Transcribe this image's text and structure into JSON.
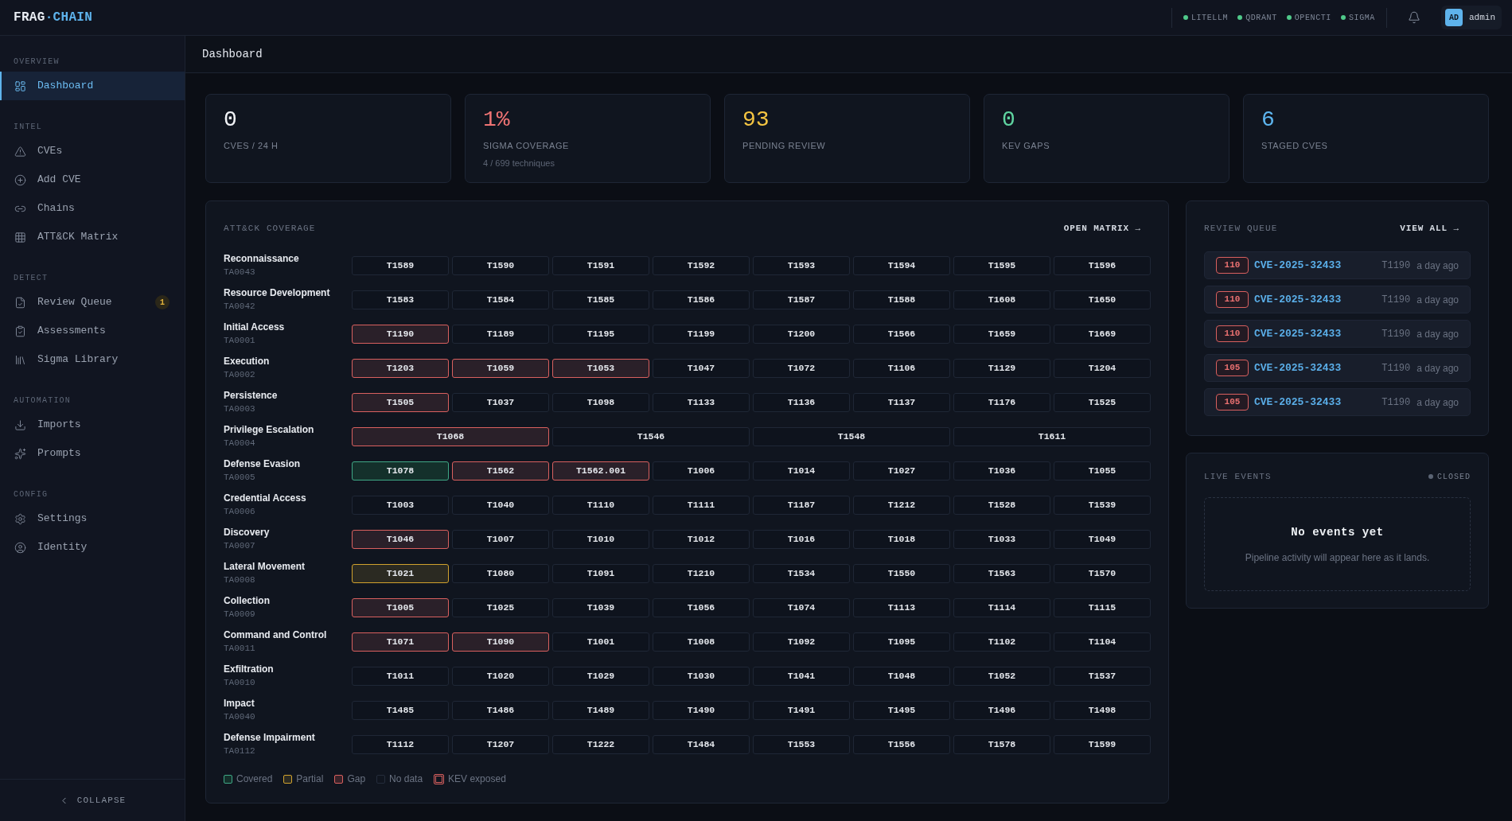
{
  "app": {
    "logo": {
      "name": "FRAG",
      "accent": "·CHAIN"
    }
  },
  "topbar": {
    "services": [
      {
        "label": "LITELLM",
        "online": true
      },
      {
        "label": "QDRANT",
        "online": true
      },
      {
        "label": "OPENCTI",
        "online": true
      },
      {
        "label": "SIGMA",
        "online": true
      }
    ],
    "user": {
      "initials": "AD",
      "name": "admin"
    }
  },
  "sidebar": {
    "sections": [
      {
        "title": "OVERVIEW",
        "items": [
          {
            "label": "Dashboard",
            "selected": true
          }
        ]
      },
      {
        "title": "INTEL",
        "items": [
          {
            "label": "CVEs",
            "selected": false
          },
          {
            "label": "Add CVE",
            "selected": false
          },
          {
            "label": "Chains",
            "selected": false
          },
          {
            "label": "ATT&CK Matrix",
            "selected": false
          }
        ]
      },
      {
        "title": "DETECT",
        "items": [
          {
            "label": "Review Queue",
            "selected": false,
            "badge": "1"
          },
          {
            "label": "Assessments",
            "selected": false
          },
          {
            "label": "Sigma Library",
            "selected": false
          }
        ]
      },
      {
        "title": "AUTOMATION",
        "items": [
          {
            "label": "Imports",
            "selected": false
          },
          {
            "label": "Prompts",
            "selected": false
          }
        ]
      },
      {
        "title": "CONFIG",
        "items": [
          {
            "label": "Settings",
            "selected": false
          },
          {
            "label": "Identity",
            "selected": false
          }
        ]
      }
    ],
    "collapse": "COLLAPSE"
  },
  "page": {
    "title": "Dashboard"
  },
  "stats": [
    {
      "value": "0",
      "label": "CVES / 24 H",
      "color": "#f1f3f6"
    },
    {
      "value": "1%",
      "label": "SIGMA COVERAGE",
      "sub": "4 / 699 techniques",
      "color": "#f07474"
    },
    {
      "value": "93",
      "label": "PENDING REVIEW",
      "color": "#f5c542"
    },
    {
      "value": "0",
      "label": "KEV GAPS",
      "color": "#5fd4a0"
    },
    {
      "value": "6",
      "label": "STAGED CVES",
      "color": "#5eb6f0"
    }
  ],
  "matrix": {
    "title": "ATT&CK COVERAGE",
    "link": "OPEN MATRIX →",
    "tactics": [
      {
        "name": "Reconnaissance",
        "id": "TA0043",
        "techniques": [
          {
            "id": "T1589",
            "kind": "none"
          },
          {
            "id": "T1590",
            "kind": "none"
          },
          {
            "id": "T1591",
            "kind": "none"
          },
          {
            "id": "T1592",
            "kind": "none"
          },
          {
            "id": "T1593",
            "kind": "none"
          },
          {
            "id": "T1594",
            "kind": "none"
          },
          {
            "id": "T1595",
            "kind": "none"
          },
          {
            "id": "T1596",
            "kind": "none"
          }
        ]
      },
      {
        "name": "Resource Development",
        "id": "TA0042",
        "techniques": [
          {
            "id": "T1583",
            "kind": "none"
          },
          {
            "id": "T1584",
            "kind": "none"
          },
          {
            "id": "T1585",
            "kind": "none"
          },
          {
            "id": "T1586",
            "kind": "none"
          },
          {
            "id": "T1587",
            "kind": "none"
          },
          {
            "id": "T1588",
            "kind": "none"
          },
          {
            "id": "T1608",
            "kind": "none"
          },
          {
            "id": "T1650",
            "kind": "none"
          }
        ]
      },
      {
        "name": "Initial Access",
        "id": "TA0001",
        "techniques": [
          {
            "id": "T1190",
            "kind": "gap"
          },
          {
            "id": "T1189",
            "kind": "none"
          },
          {
            "id": "T1195",
            "kind": "none"
          },
          {
            "id": "T1199",
            "kind": "none"
          },
          {
            "id": "T1200",
            "kind": "none"
          },
          {
            "id": "T1566",
            "kind": "none"
          },
          {
            "id": "T1659",
            "kind": "none"
          },
          {
            "id": "T1669",
            "kind": "none"
          }
        ]
      },
      {
        "name": "Execution",
        "id": "TA0002",
        "techniques": [
          {
            "id": "T1203",
            "kind": "gap"
          },
          {
            "id": "T1059",
            "kind": "gap"
          },
          {
            "id": "T1053",
            "kind": "gap"
          },
          {
            "id": "T1047",
            "kind": "none"
          },
          {
            "id": "T1072",
            "kind": "none"
          },
          {
            "id": "T1106",
            "kind": "none"
          },
          {
            "id": "T1129",
            "kind": "none"
          },
          {
            "id": "T1204",
            "kind": "none"
          }
        ]
      },
      {
        "name": "Persistence",
        "id": "TA0003",
        "techniques": [
          {
            "id": "T1505",
            "kind": "gap"
          },
          {
            "id": "T1037",
            "kind": "none"
          },
          {
            "id": "T1098",
            "kind": "none"
          },
          {
            "id": "T1133",
            "kind": "none"
          },
          {
            "id": "T1136",
            "kind": "none"
          },
          {
            "id": "T1137",
            "kind": "none"
          },
          {
            "id": "T1176",
            "kind": "none"
          },
          {
            "id": "T1525",
            "kind": "none"
          }
        ]
      },
      {
        "name": "Privilege Escalation",
        "id": "TA0004",
        "techniques": [
          {
            "id": "T1068",
            "kind": "gap"
          },
          {
            "id": "T1546",
            "kind": "none"
          },
          {
            "id": "T1548",
            "kind": "none"
          },
          {
            "id": "T1611",
            "kind": "none"
          }
        ]
      },
      {
        "name": "Defense Evasion",
        "id": "TA0005",
        "techniques": [
          {
            "id": "T1078",
            "kind": "covered"
          },
          {
            "id": "T1562",
            "kind": "gap"
          },
          {
            "id": "T1562.001",
            "kind": "gap"
          },
          {
            "id": "T1006",
            "kind": "none"
          },
          {
            "id": "T1014",
            "kind": "none"
          },
          {
            "id": "T1027",
            "kind": "none"
          },
          {
            "id": "T1036",
            "kind": "none"
          },
          {
            "id": "T1055",
            "kind": "none"
          }
        ]
      },
      {
        "name": "Credential Access",
        "id": "TA0006",
        "techniques": [
          {
            "id": "T1003",
            "kind": "none"
          },
          {
            "id": "T1040",
            "kind": "none"
          },
          {
            "id": "T1110",
            "kind": "none"
          },
          {
            "id": "T1111",
            "kind": "none"
          },
          {
            "id": "T1187",
            "kind": "none"
          },
          {
            "id": "T1212",
            "kind": "none"
          },
          {
            "id": "T1528",
            "kind": "none"
          },
          {
            "id": "T1539",
            "kind": "none"
          }
        ]
      },
      {
        "name": "Discovery",
        "id": "TA0007",
        "techniques": [
          {
            "id": "T1046",
            "kind": "gap"
          },
          {
            "id": "T1007",
            "kind": "none"
          },
          {
            "id": "T1010",
            "kind": "none"
          },
          {
            "id": "T1012",
            "kind": "none"
          },
          {
            "id": "T1016",
            "kind": "none"
          },
          {
            "id": "T1018",
            "kind": "none"
          },
          {
            "id": "T1033",
            "kind": "none"
          },
          {
            "id": "T1049",
            "kind": "none"
          }
        ]
      },
      {
        "name": "Lateral Movement",
        "id": "TA0008",
        "techniques": [
          {
            "id": "T1021",
            "kind": "partial"
          },
          {
            "id": "T1080",
            "kind": "none"
          },
          {
            "id": "T1091",
            "kind": "none"
          },
          {
            "id": "T1210",
            "kind": "none"
          },
          {
            "id": "T1534",
            "kind": "none"
          },
          {
            "id": "T1550",
            "kind": "none"
          },
          {
            "id": "T1563",
            "kind": "none"
          },
          {
            "id": "T1570",
            "kind": "none"
          }
        ]
      },
      {
        "name": "Collection",
        "id": "TA0009",
        "techniques": [
          {
            "id": "T1005",
            "kind": "gap"
          },
          {
            "id": "T1025",
            "kind": "none"
          },
          {
            "id": "T1039",
            "kind": "none"
          },
          {
            "id": "T1056",
            "kind": "none"
          },
          {
            "id": "T1074",
            "kind": "none"
          },
          {
            "id": "T1113",
            "kind": "none"
          },
          {
            "id": "T1114",
            "kind": "none"
          },
          {
            "id": "T1115",
            "kind": "none"
          }
        ]
      },
      {
        "name": "Command and Control",
        "id": "TA0011",
        "techniques": [
          {
            "id": "T1071",
            "kind": "gap"
          },
          {
            "id": "T1090",
            "kind": "gap"
          },
          {
            "id": "T1001",
            "kind": "none"
          },
          {
            "id": "T1008",
            "kind": "none"
          },
          {
            "id": "T1092",
            "kind": "none"
          },
          {
            "id": "T1095",
            "kind": "none"
          },
          {
            "id": "T1102",
            "kind": "none"
          },
          {
            "id": "T1104",
            "kind": "none"
          }
        ]
      },
      {
        "name": "Exfiltration",
        "id": "TA0010",
        "techniques": [
          {
            "id": "T1011",
            "kind": "none"
          },
          {
            "id": "T1020",
            "kind": "none"
          },
          {
            "id": "T1029",
            "kind": "none"
          },
          {
            "id": "T1030",
            "kind": "none"
          },
          {
            "id": "T1041",
            "kind": "none"
          },
          {
            "id": "T1048",
            "kind": "none"
          },
          {
            "id": "T1052",
            "kind": "none"
          },
          {
            "id": "T1537",
            "kind": "none"
          }
        ]
      },
      {
        "name": "Impact",
        "id": "TA0040",
        "techniques": [
          {
            "id": "T1485",
            "kind": "none"
          },
          {
            "id": "T1486",
            "kind": "none"
          },
          {
            "id": "T1489",
            "kind": "none"
          },
          {
            "id": "T1490",
            "kind": "none"
          },
          {
            "id": "T1491",
            "kind": "none"
          },
          {
            "id": "T1495",
            "kind": "none"
          },
          {
            "id": "T1496",
            "kind": "none"
          },
          {
            "id": "T1498",
            "kind": "none"
          }
        ]
      },
      {
        "name": "Defense Impairment",
        "id": "TA0112",
        "techniques": [
          {
            "id": "T1112",
            "kind": "none"
          },
          {
            "id": "T1207",
            "kind": "none"
          },
          {
            "id": "T1222",
            "kind": "none"
          },
          {
            "id": "T1484",
            "kind": "none"
          },
          {
            "id": "T1553",
            "kind": "none"
          },
          {
            "id": "T1556",
            "kind": "none"
          },
          {
            "id": "T1578",
            "kind": "none"
          },
          {
            "id": "T1599",
            "kind": "none"
          }
        ]
      }
    ],
    "legend": [
      {
        "label": "Covered",
        "kind": "covered"
      },
      {
        "label": "Partial",
        "kind": "partial"
      },
      {
        "label": "Gap",
        "kind": "gap"
      },
      {
        "label": "No data",
        "kind": "none"
      },
      {
        "label": "KEV exposed",
        "kind": "kev"
      }
    ]
  },
  "review_queue": {
    "title": "REVIEW QUEUE",
    "link": "VIEW ALL →",
    "items": [
      {
        "score": "110",
        "cve": "CVE-2025-32433",
        "technique": "T1190",
        "time": "a day ago"
      },
      {
        "score": "110",
        "cve": "CVE-2025-32433",
        "technique": "T1190",
        "time": "a day ago"
      },
      {
        "score": "110",
        "cve": "CVE-2025-32433",
        "technique": "T1190",
        "time": "a day ago"
      },
      {
        "score": "105",
        "cve": "CVE-2025-32433",
        "technique": "T1190",
        "time": "a day ago"
      },
      {
        "score": "105",
        "cve": "CVE-2025-32433",
        "technique": "T1190",
        "time": "a day ago"
      }
    ]
  },
  "live_events": {
    "title": "LIVE EVENTS",
    "status": "CLOSED",
    "connected": false,
    "empty_title": "No events yet",
    "empty_text": "Pipeline activity will appear here as it lands."
  }
}
